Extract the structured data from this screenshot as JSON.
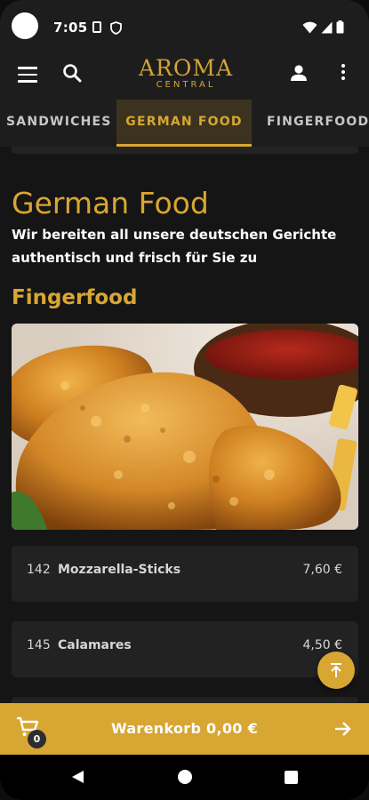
{
  "status_bar": {
    "time": "7:05"
  },
  "header": {
    "logo_main": "AROMA",
    "logo_sub": "CENTRAL"
  },
  "tabs": [
    {
      "label": "SANDWICHES",
      "active": false
    },
    {
      "label": "GERMAN FOOD",
      "active": true
    },
    {
      "label": "FINGERFOOD",
      "active": false
    }
  ],
  "main": {
    "title": "German Food",
    "description": "Wir bereiten all unsere deutschen Gerichte authentisch und frisch für Sie zu",
    "section_title": "Fingerfood",
    "items": [
      {
        "number": "142",
        "name": "Mozzarella-Sticks",
        "price": "7,60 €"
      },
      {
        "number": "145",
        "name": "Calamares",
        "price": "4,50 €"
      }
    ]
  },
  "cart": {
    "label": "Warenkorb 0,00 €",
    "count": "0"
  },
  "colors": {
    "accent": "#d8a632",
    "background": "#151515",
    "card": "#222222",
    "header": "#1d1d1d"
  },
  "icons": [
    "menu-icon",
    "search-icon",
    "user-icon",
    "more-vert-icon",
    "arrow-up-icon",
    "cart-icon",
    "arrow-right-icon",
    "back-icon",
    "home-icon",
    "recents-icon"
  ]
}
